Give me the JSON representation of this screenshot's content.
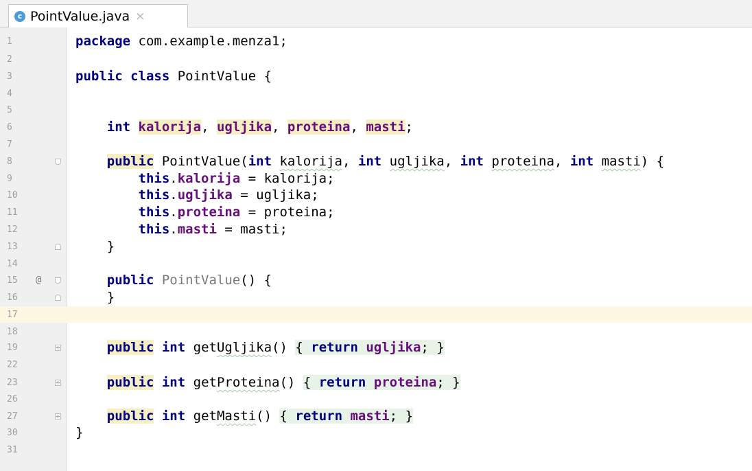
{
  "tab": {
    "icon": "c",
    "title": "PointValue.java",
    "close": "×"
  },
  "lines": [
    {
      "n": "1",
      "tokens": [
        {
          "t": "package",
          "c": "kw"
        },
        {
          "t": " com.example.menza1;"
        }
      ]
    },
    {
      "n": "2",
      "tokens": []
    },
    {
      "n": "3",
      "tokens": [
        {
          "t": "public",
          "c": "kw"
        },
        {
          "t": " "
        },
        {
          "t": "class",
          "c": "kw"
        },
        {
          "t": " PointValue {"
        }
      ]
    },
    {
      "n": "4",
      "tokens": []
    },
    {
      "n": "5",
      "tokens": []
    },
    {
      "n": "6",
      "tokens": [
        {
          "t": "    "
        },
        {
          "t": "int",
          "c": "kw"
        },
        {
          "t": " "
        },
        {
          "t": "kalorija",
          "c": "fld hl"
        },
        {
          "t": ", "
        },
        {
          "t": "ugljika",
          "c": "fld hl"
        },
        {
          "t": ", "
        },
        {
          "t": "proteina",
          "c": "fld hl"
        },
        {
          "t": ", "
        },
        {
          "t": "masti",
          "c": "fld hl"
        },
        {
          "t": ";"
        }
      ]
    },
    {
      "n": "7",
      "tokens": []
    },
    {
      "n": "8",
      "fold": "minus",
      "tokens": [
        {
          "t": "    "
        },
        {
          "t": "public",
          "c": "kw hl"
        },
        {
          "t": " PointValue("
        },
        {
          "t": "int",
          "c": "kw"
        },
        {
          "t": " "
        },
        {
          "t": "kalorija",
          "c": "squig"
        },
        {
          "t": ", "
        },
        {
          "t": "int",
          "c": "kw"
        },
        {
          "t": " "
        },
        {
          "t": "ugljika",
          "c": "squig"
        },
        {
          "t": ", "
        },
        {
          "t": "int",
          "c": "kw"
        },
        {
          "t": " "
        },
        {
          "t": "proteina",
          "c": "squig"
        },
        {
          "t": ", "
        },
        {
          "t": "int",
          "c": "kw"
        },
        {
          "t": " "
        },
        {
          "t": "masti",
          "c": "squig"
        },
        {
          "t": ") {"
        }
      ]
    },
    {
      "n": "9",
      "tokens": [
        {
          "t": "        "
        },
        {
          "t": "this",
          "c": "kw"
        },
        {
          "t": "."
        },
        {
          "t": "kalorija",
          "c": "fld"
        },
        {
          "t": " = kalorija;"
        }
      ]
    },
    {
      "n": "10",
      "tokens": [
        {
          "t": "        "
        },
        {
          "t": "this",
          "c": "kw"
        },
        {
          "t": "."
        },
        {
          "t": "ugljika",
          "c": "fld"
        },
        {
          "t": " = ugljika;"
        }
      ]
    },
    {
      "n": "11",
      "tokens": [
        {
          "t": "        "
        },
        {
          "t": "this",
          "c": "kw"
        },
        {
          "t": "."
        },
        {
          "t": "proteina",
          "c": "fld"
        },
        {
          "t": " = proteina;"
        }
      ]
    },
    {
      "n": "12",
      "tokens": [
        {
          "t": "        "
        },
        {
          "t": "this",
          "c": "kw"
        },
        {
          "t": "."
        },
        {
          "t": "masti",
          "c": "fld"
        },
        {
          "t": " = masti;"
        }
      ]
    },
    {
      "n": "13",
      "fold": "end",
      "tokens": [
        {
          "t": "    }"
        }
      ]
    },
    {
      "n": "14",
      "tokens": []
    },
    {
      "n": "15",
      "at": "@",
      "fold": "minus",
      "tokens": [
        {
          "t": "    "
        },
        {
          "t": "public",
          "c": "kw"
        },
        {
          "t": " "
        },
        {
          "t": "PointValue",
          "c": "meth-gray"
        },
        {
          "t": "() {"
        }
      ]
    },
    {
      "n": "16",
      "fold": "end",
      "tokens": [
        {
          "t": "    }"
        }
      ]
    },
    {
      "n": "17",
      "current": true,
      "tokens": []
    },
    {
      "n": "18",
      "tokens": []
    },
    {
      "n": "19",
      "fold": "plus",
      "tokens": [
        {
          "t": "    "
        },
        {
          "t": "public",
          "c": "kw hl"
        },
        {
          "t": " "
        },
        {
          "t": "int",
          "c": "kw"
        },
        {
          "t": " get"
        },
        {
          "t": "Ugljika",
          "c": "squig"
        },
        {
          "t": "() "
        },
        {
          "t": "{ ",
          "c": "fold-bg"
        },
        {
          "t": "return",
          "c": "kw fold-bg"
        },
        {
          "t": " ",
          "c": "fold-bg"
        },
        {
          "t": "ugljika",
          "c": "fld fold-bg"
        },
        {
          "t": "; }",
          "c": "fold-bg"
        }
      ]
    },
    {
      "n": "22",
      "tokens": []
    },
    {
      "n": "23",
      "fold": "plus",
      "tokens": [
        {
          "t": "    "
        },
        {
          "t": "public",
          "c": "kw hl"
        },
        {
          "t": " "
        },
        {
          "t": "int",
          "c": "kw"
        },
        {
          "t": " get"
        },
        {
          "t": "Proteina",
          "c": "squig"
        },
        {
          "t": "() "
        },
        {
          "t": "{ ",
          "c": "fold-bg"
        },
        {
          "t": "return",
          "c": "kw fold-bg"
        },
        {
          "t": " ",
          "c": "fold-bg"
        },
        {
          "t": "proteina",
          "c": "fld fold-bg"
        },
        {
          "t": "; }",
          "c": "fold-bg"
        }
      ]
    },
    {
      "n": "26",
      "tokens": []
    },
    {
      "n": "27",
      "fold": "plus",
      "tokens": [
        {
          "t": "    "
        },
        {
          "t": "public",
          "c": "kw hl"
        },
        {
          "t": " "
        },
        {
          "t": "int",
          "c": "kw"
        },
        {
          "t": " get"
        },
        {
          "t": "Masti",
          "c": "squig"
        },
        {
          "t": "() "
        },
        {
          "t": "{ ",
          "c": "fold-bg"
        },
        {
          "t": "return",
          "c": "kw fold-bg"
        },
        {
          "t": " ",
          "c": "fold-bg"
        },
        {
          "t": "masti",
          "c": "fld fold-bg"
        },
        {
          "t": "; }",
          "c": "fold-bg"
        }
      ]
    },
    {
      "n": "30",
      "tokens": [
        {
          "t": "}"
        }
      ]
    },
    {
      "n": "31",
      "tokens": []
    }
  ]
}
